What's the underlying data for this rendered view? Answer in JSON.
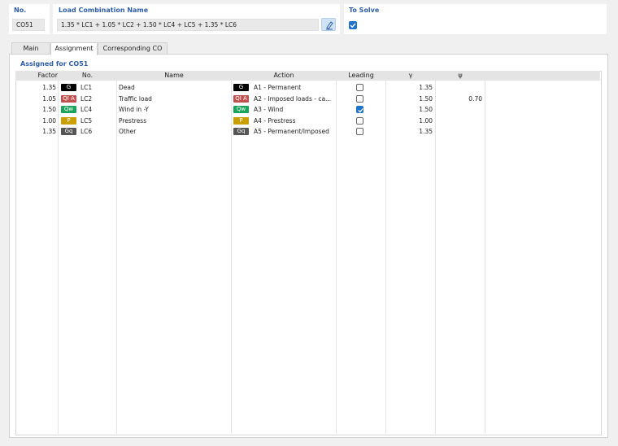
{
  "header": {
    "no_label": "No.",
    "no_value": "CO51",
    "name_label": "Load Combination Name",
    "name_value": "1.35 * LC1 + 1.05 * LC2 + 1.50 * LC4 + LC5 + 1.35 * LC6",
    "edit_icon": "edit-pencil-icon",
    "solve_label": "To Solve",
    "solve_checked": true
  },
  "tabs": [
    {
      "label": "Main",
      "active": false
    },
    {
      "label": "Assignment",
      "active": true
    },
    {
      "label": "Corresponding CO",
      "active": false
    }
  ],
  "section_title": "Assigned for CO51",
  "table": {
    "columns": [
      "Factor",
      "No.",
      "Name",
      "Action",
      "Leading",
      "γ",
      "ψ"
    ],
    "rows": [
      {
        "factor": "1.35",
        "lc_badge": "G",
        "lc_color": "#000000",
        "lc_no": "LC1",
        "name": "Dead",
        "act_badge": "G",
        "act_color": "#000000",
        "action": "A1 - Permanent",
        "leading": false,
        "gamma": "1.35",
        "psi": ""
      },
      {
        "factor": "1.05",
        "lc_badge": "QI A",
        "lc_color": "#c0504d",
        "lc_no": "LC2",
        "name": "Traffic load",
        "act_badge": "QI A",
        "act_color": "#c0504d",
        "action": "A2 - Imposed loads - ca...",
        "leading": false,
        "gamma": "1.50",
        "psi": "0.70"
      },
      {
        "factor": "1.50",
        "lc_badge": "Qw",
        "lc_color": "#1aa35a",
        "lc_no": "LC4",
        "name": "Wind in -Y",
        "act_badge": "Qw",
        "act_color": "#1aa35a",
        "action": "A3 - Wind",
        "leading": true,
        "gamma": "1.50",
        "psi": ""
      },
      {
        "factor": "1.00",
        "lc_badge": "P",
        "lc_color": "#c9a000",
        "lc_no": "LC5",
        "name": "Prestress",
        "act_badge": "P",
        "act_color": "#c9a000",
        "action": "A4 - Prestress",
        "leading": false,
        "gamma": "1.00",
        "psi": ""
      },
      {
        "factor": "1.35",
        "lc_badge": "Gq",
        "lc_color": "#555555",
        "lc_no": "LC6",
        "name": "Other",
        "act_badge": "Gq",
        "act_color": "#555555",
        "action": "A5 - Permanent/Imposed",
        "leading": false,
        "gamma": "1.35",
        "psi": ""
      }
    ]
  }
}
